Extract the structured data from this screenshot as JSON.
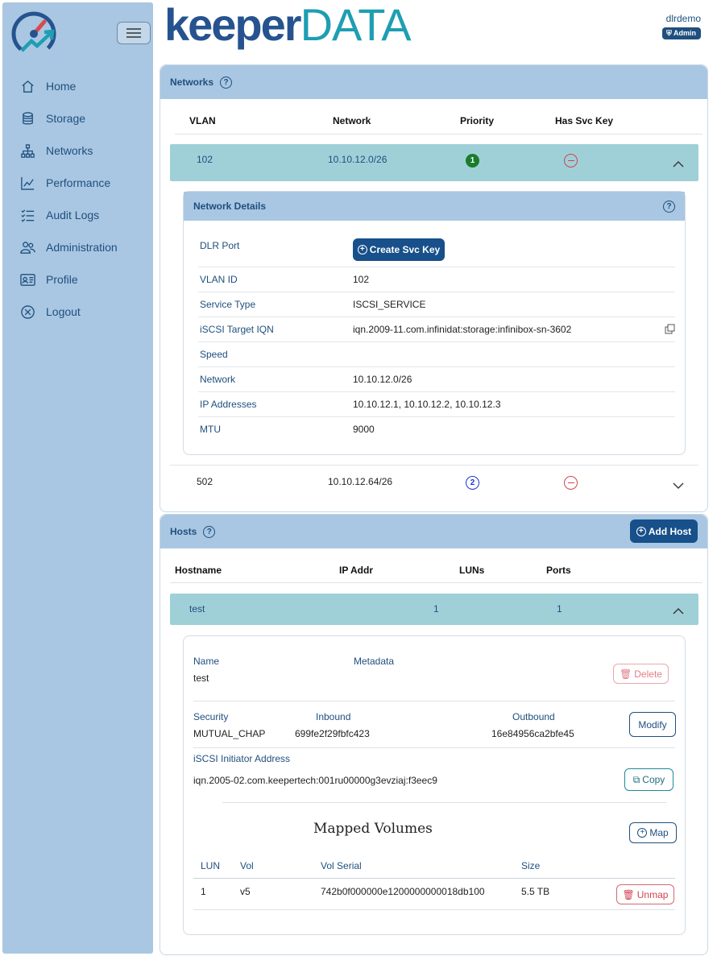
{
  "sidebar": {
    "items": [
      {
        "label": "Home",
        "icon": "home-icon"
      },
      {
        "label": "Storage",
        "icon": "database-icon"
      },
      {
        "label": "Networks",
        "icon": "network-icon"
      },
      {
        "label": "Performance",
        "icon": "chart-line-icon"
      },
      {
        "label": "Audit Logs",
        "icon": "list-check-icon"
      },
      {
        "label": "Administration",
        "icon": "users-icon"
      },
      {
        "label": "Profile",
        "icon": "id-card-icon"
      },
      {
        "label": "Logout",
        "icon": "close-circle-icon"
      }
    ]
  },
  "header": {
    "brand_part1": "keeper",
    "brand_part2": "DATA",
    "username": "dlrdemo",
    "role": "Admin"
  },
  "networks": {
    "title": "Networks",
    "columns": [
      "VLAN",
      "Network",
      "Priority",
      "Has Svc Key"
    ],
    "rows": [
      {
        "vlan": "102",
        "network": "10.10.12.0/26",
        "priority": "1"
      },
      {
        "vlan": "502",
        "network": "10.10.12.64/26",
        "priority": "2"
      }
    ],
    "details": {
      "title": "Network Details",
      "create_svc_key": "Create Svc Key",
      "fields": [
        {
          "label": "DLR Port",
          "value": ""
        },
        {
          "label": "VLAN ID",
          "value": "102"
        },
        {
          "label": "Service Type",
          "value": "ISCSI_SERVICE"
        },
        {
          "label": "iSCSI Target IQN",
          "value": "iqn.2009-11.com.infinidat:storage:infinibox-sn-3602"
        },
        {
          "label": "Speed",
          "value": ""
        },
        {
          "label": "Network",
          "value": "10.10.12.0/26"
        },
        {
          "label": "IP Addresses",
          "value": "10.10.12.1, 10.10.12.2, 10.10.12.3"
        },
        {
          "label": "MTU",
          "value": "9000"
        }
      ]
    }
  },
  "hosts": {
    "title": "Hosts",
    "add_host": "Add Host",
    "columns": [
      "Hostname",
      "IP Addr",
      "LUNs",
      "Ports"
    ],
    "rows": [
      {
        "hostname": "test",
        "ip": "",
        "luns": "1",
        "ports": "1"
      }
    ],
    "detail": {
      "name_label": "Name",
      "name_value": "test",
      "metadata_label": "Metadata",
      "delete": "Delete",
      "security_label": "Security",
      "security_value": "MUTUAL_CHAP",
      "inbound_label": "Inbound",
      "inbound_value": "699fe2f29fbfc423",
      "outbound_label": "Outbound",
      "outbound_value": "16e84956ca2bfe45",
      "modify": "Modify",
      "initiator_label": "iSCSI Initiator Address",
      "initiator_value": "iqn.2005-02.com.keepertech:001ru00000g3evziaj:f3eec9",
      "copy": "Copy",
      "mapped_title": "Mapped Volumes",
      "map": "Map",
      "vol_columns": [
        "LUN",
        "Vol",
        "Vol Serial",
        "Size"
      ],
      "volumes": [
        {
          "lun": "1",
          "vol": "v5",
          "serial": "742b0f000000e1200000000018db100",
          "size": "5.5 TB"
        }
      ],
      "unmap": "Unmap"
    }
  },
  "colors": {
    "sidebar": "#a9c7e2",
    "primary": "#17508a",
    "expanded_row": "#9fd0d8",
    "brand_blue": "#26538f",
    "brand_teal": "#1e9eb3"
  }
}
